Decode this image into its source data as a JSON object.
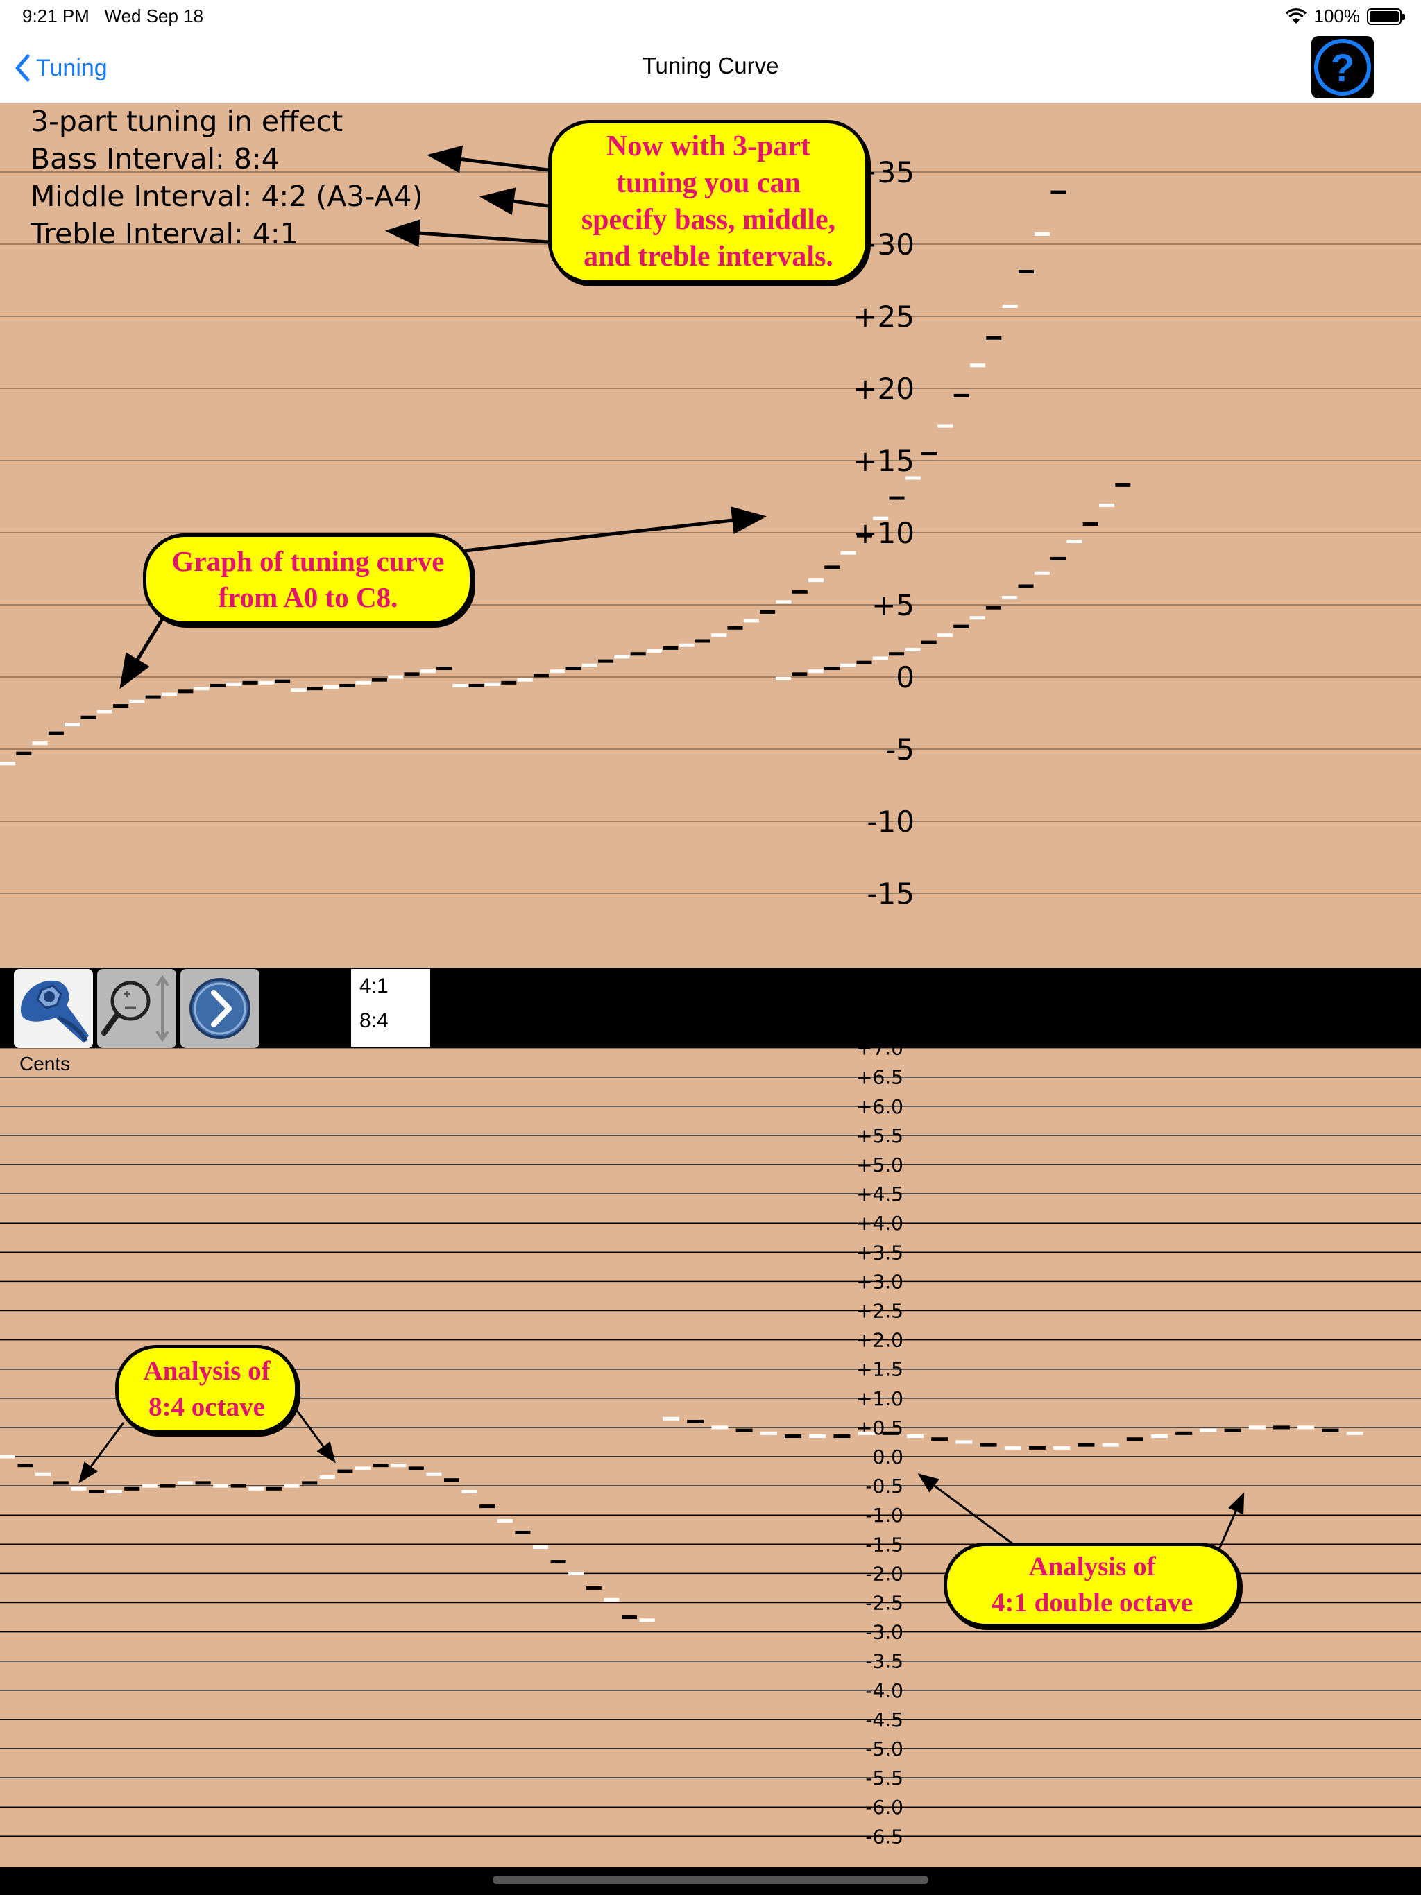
{
  "status_bar": {
    "time": "9:21 PM",
    "date": "Wed Sep 18",
    "battery": "100%",
    "wifi_icon": "wifi-icon",
    "battery_icon": "battery-icon"
  },
  "nav": {
    "back_label": "Tuning",
    "title": "Tuning Curve",
    "help_icon": "question-icon"
  },
  "info": {
    "line1": "3-part tuning in effect",
    "line2": "Bass Interval: 8:4",
    "line3": "Middle Interval: 4:2 (A3-A4)",
    "line4": "Treble Interval: 4:1"
  },
  "callouts": {
    "top": [
      "Now with 3-part",
      "tuning you can",
      "specify bass, middle,",
      "and treble intervals."
    ],
    "graph": [
      "Graph of tuning curve",
      "from A0 to C8."
    ],
    "analysis_84": [
      "Analysis of",
      "8:4 octave"
    ],
    "analysis_41": [
      "Analysis of",
      "4:1 double octave"
    ]
  },
  "toolbar": {
    "settings_icon": "wrench-settings-icon",
    "zoom_icon": "zoom-icon",
    "next_icon": "chevron-right-icon",
    "interval_list": [
      "4:1",
      "8:4"
    ]
  },
  "colors": {
    "chart_bg": "#e0b594",
    "callout_bg": "#ffff00",
    "callout_text": "#e0156e",
    "accent": "#1a7cf5"
  },
  "chart_data": [
    {
      "type": "scatter",
      "title": "",
      "ylabel": "",
      "yticks": [
        "+35",
        "+30",
        "+25",
        "+20",
        "+15",
        "+10",
        "+5",
        "0",
        "-5",
        "-10",
        "-15"
      ],
      "ylim": [
        -20,
        38
      ],
      "xlim": [
        0,
        88
      ],
      "series": [
        {
          "x": [
            0,
            1,
            2,
            3,
            4,
            5,
            6,
            7,
            8,
            9,
            10,
            11,
            12,
            13,
            14,
            15,
            16,
            17,
            18,
            19,
            20,
            21,
            22,
            23,
            24,
            25,
            26,
            27,
            28,
            29,
            30,
            31,
            32,
            33,
            34,
            35,
            36,
            37,
            38,
            39,
            40,
            41,
            42,
            43,
            44,
            45,
            46,
            47,
            48,
            49,
            50,
            51,
            52,
            53,
            54,
            55,
            56,
            57,
            58,
            59,
            60,
            61,
            62,
            63,
            64,
            65,
            66,
            67,
            68,
            69,
            70,
            71,
            72,
            73,
            74,
            75,
            76,
            77,
            78,
            79,
            80,
            81,
            82,
            83,
            84,
            85,
            86,
            87
          ],
          "values": [
            -6,
            -5.3,
            -4.6,
            -3.9,
            -3.3,
            -2.8,
            -2.4,
            -2.0,
            -1.7,
            -1.4,
            -1.2,
            -1.0,
            -0.8,
            -0.6,
            -0.5,
            -0.4,
            -0.4,
            -0.3,
            -0.9,
            -0.8,
            -0.7,
            -0.6,
            -0.4,
            -0.2,
            0.0,
            0.2,
            0.4,
            0.6,
            -0.6,
            -0.6,
            -0.5,
            -0.4,
            -0.2,
            0.1,
            0.4,
            0.6,
            0.8,
            1.1,
            1.4,
            1.6,
            1.8,
            2.0,
            2.2,
            2.5,
            2.9,
            3.4,
            3.9,
            4.5,
            5.2,
            5.9,
            6.7,
            7.6,
            8.6,
            9.8,
            11.0,
            12.4,
            13.8,
            15.5,
            17.4,
            19.5,
            21.6,
            23.5,
            25.7,
            28.1,
            30.7,
            33.6,
            -0.1,
            0.2,
            0.4,
            0.6,
            0.8,
            1.0,
            1.3,
            1.6,
            1.9,
            2.4,
            2.9,
            3.5,
            4.1,
            4.8,
            5.5,
            6.3,
            7.2,
            8.2,
            9.4,
            10.6,
            11.9,
            13.3
          ]
        }
      ],
      "grid": true
    },
    {
      "type": "scatter",
      "title": "",
      "ylabel": "Cents",
      "yticks": [
        "+7.0",
        "+6.5",
        "+6.0",
        "+5.5",
        "+5.0",
        "+4.5",
        "+4.0",
        "+3.5",
        "+3.0",
        "+2.5",
        "+2.0",
        "+1.5",
        "+1.0",
        "+0.5",
        "0.0",
        "-0.5",
        "-1.0",
        "-1.5",
        "-2.0",
        "-2.5",
        "-3.0",
        "-3.5",
        "-4.0",
        "-4.5",
        "-5.0",
        "-5.5",
        "-6.0",
        "-6.5"
      ],
      "ylim": [
        -7,
        7.5
      ],
      "grid": true,
      "series": [
        {
          "name": "8:4",
          "x": [
            0,
            1,
            2,
            3,
            4,
            5,
            6,
            7,
            8,
            9,
            10,
            11,
            12,
            13,
            14,
            15,
            16,
            17,
            18,
            19,
            20,
            21,
            22,
            23,
            24,
            25,
            26,
            27,
            28,
            29,
            30,
            31,
            32,
            33,
            34,
            35,
            36,
            37,
            38,
            39
          ],
          "values": [
            0.0,
            -0.15,
            -0.3,
            -0.45,
            -0.55,
            -0.6,
            -0.6,
            -0.55,
            -0.5,
            -0.5,
            -0.45,
            -0.45,
            -0.5,
            -0.5,
            -0.55,
            -0.55,
            -0.5,
            -0.45,
            -0.35,
            -0.25,
            -0.2,
            -0.15,
            -0.15,
            -0.2,
            -0.3,
            -0.4,
            -0.6,
            -0.85,
            -1.1,
            -1.3,
            -1.55,
            -1.8,
            -2.0,
            -2.25,
            -2.45,
            -2.75,
            -2.8,
            -2.8,
            -2.8,
            -2.8
          ]
        },
        {
          "name": "4:1",
          "x": [
            40,
            41,
            42,
            43,
            44,
            45,
            46,
            47,
            48,
            49,
            50,
            51,
            52,
            53,
            54,
            55,
            56,
            57,
            58,
            59,
            60,
            61,
            62,
            63,
            64,
            65,
            66,
            67,
            68,
            69,
            70,
            71,
            72,
            73,
            74,
            75,
            76,
            77,
            78,
            79,
            80,
            81,
            82,
            83,
            84,
            85
          ],
          "values": [
            0.65,
            0.6,
            0.5,
            0.45,
            0.4,
            0.35,
            0.35,
            0.35,
            0.4,
            0.4,
            0.35,
            0.3,
            0.25,
            0.2,
            0.15,
            0.15,
            0.15,
            0.2,
            0.2,
            0.3,
            0.35,
            0.4,
            0.45,
            0.45,
            0.5,
            0.5,
            0.5,
            0.45,
            0.4,
            0.35,
            0.3,
            0.25,
            0.2,
            0.1,
            0.0,
            0.0,
            0.0,
            0.0,
            0.0,
            0.0,
            0.0,
            0.0,
            0.0,
            0.0,
            0.0,
            0.0
          ]
        }
      ]
    }
  ]
}
